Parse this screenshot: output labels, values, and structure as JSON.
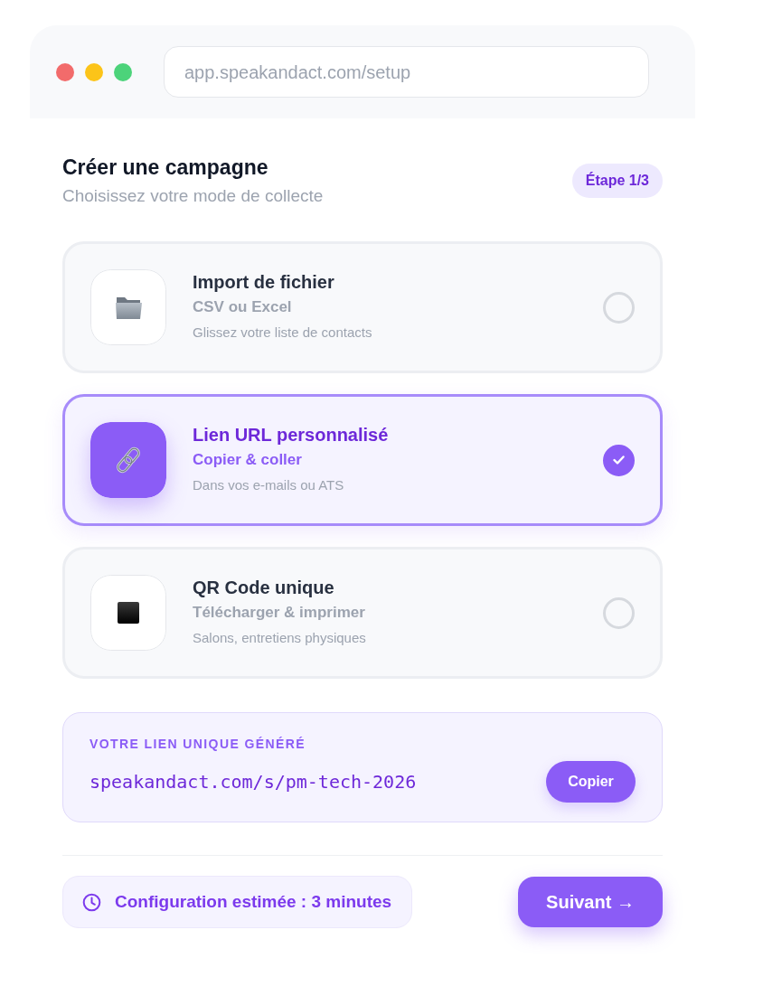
{
  "browser": {
    "url": "app.speakandact.com/setup"
  },
  "header": {
    "title": "Créer une campagne",
    "subtitle": "Choisissez votre mode de collecte",
    "step_badge": "Étape 1/3"
  },
  "options": [
    {
      "kind": "file",
      "title": "Import de fichier",
      "subtitle": "CSV ou Excel",
      "description": "Glissez votre liste de contacts",
      "selected": false
    },
    {
      "kind": "link",
      "title": "Lien URL personnalisé",
      "subtitle": "Copier & coller",
      "description": "Dans vos e-mails ou ATS",
      "selected": true
    },
    {
      "kind": "qr",
      "title": "QR Code unique",
      "subtitle": "Télécharger & imprimer",
      "description": "Salons, entretiens physiques",
      "selected": false
    }
  ],
  "generated_link": {
    "label": "VOTRE LIEN UNIQUE GÉNÉRÉ",
    "url": "speakandact.com/s/pm-tech-2026",
    "copy_button": "Copier"
  },
  "footer": {
    "estimate": "Configuration estimée : 3 minutes",
    "next_button": "Suivant →"
  }
}
